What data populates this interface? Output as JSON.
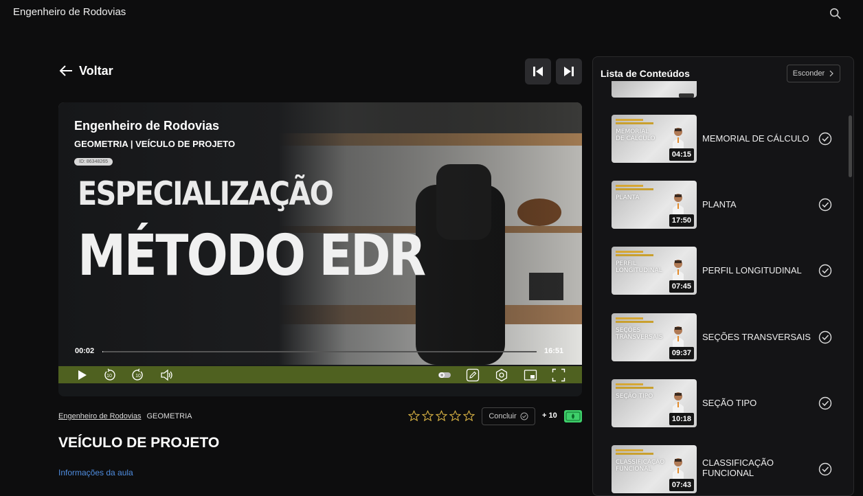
{
  "app": {
    "title": "Engenheiro de Rodovias"
  },
  "nav": {
    "back_label": "Voltar"
  },
  "video": {
    "course_title": "Engenheiro de Rodovias",
    "module_title": "GEOMETRIA | VEÍCULO DE PROJETO",
    "id_badge": "ID: 86348265",
    "headline_1": "ESPECIALIZAÇÃO",
    "headline_2": "MÉTODO EDR",
    "time_current": "00:02",
    "time_total": "16:51",
    "progress_fraction": 0.002
  },
  "lesson": {
    "breadcrumb_course": "Engenheiro de Rodovias",
    "breadcrumb_module": "GEOMETRIA",
    "title": "VEÍCULO DE PROJETO",
    "info_link": "Informações da aula",
    "rating_stars": 0,
    "rating_max": 5,
    "complete_label": "Concluir",
    "points": "+ 10"
  },
  "sidebar": {
    "title": "Lista de Conteúdos",
    "hide_label": "Esconder",
    "items": [
      {
        "thumb_text": "MEMORIAL DE CÁLCULO",
        "duration": "04:15",
        "label": "MEMORIAL DE CÁLCULO"
      },
      {
        "thumb_text": "PLANTA",
        "duration": "17:50",
        "label": "PLANTA"
      },
      {
        "thumb_text": "PERFIL LONGITUDINAL",
        "duration": "07:45",
        "label": "PERFIL LONGITUDINAL"
      },
      {
        "thumb_text": "SEÇÕES TRANSVERSAIS",
        "duration": "09:37",
        "label": "SEÇÕES TRANSVERSAIS"
      },
      {
        "thumb_text": "SEÇÃO TIPO",
        "duration": "10:18",
        "label": "SEÇÃO TIPO"
      },
      {
        "thumb_text": "CLASSIFICAÇÃO FUNCIONAL",
        "duration": "07:43",
        "label": "CLASSIFICAÇÃO FUNCIONAL"
      }
    ]
  },
  "colors": {
    "accent": "#4f6120",
    "link": "#4f8de0",
    "coin": "#3ecf6a",
    "star": "#d9b344"
  }
}
